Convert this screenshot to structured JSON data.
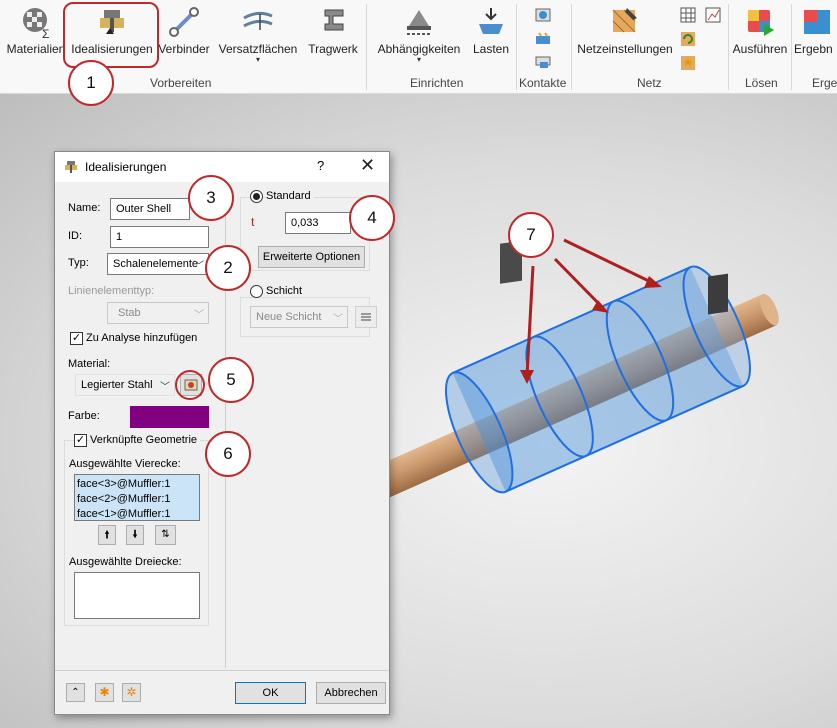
{
  "ribbon": {
    "buttons": [
      {
        "label": "Materialien"
      },
      {
        "label": "Idealisierungen"
      },
      {
        "label": "Verbinder"
      },
      {
        "label": "Versatzflächen"
      },
      {
        "label": "Tragwerk"
      },
      {
        "label": "Abhängigkeiten"
      },
      {
        "label": "Lasten"
      },
      {
        "label": "Netzeinstellungen"
      },
      {
        "label": "Ausführen"
      },
      {
        "label": "Ergebn"
      }
    ],
    "groups": [
      "Vorbereiten",
      "Einrichten",
      "Kontakte",
      "Netz",
      "Lösen",
      "Erge"
    ]
  },
  "dialog": {
    "title": "Idealisierungen",
    "help": "?",
    "close": "✕",
    "name_label": "Name:",
    "name_value": "Outer Shell",
    "id_label": "ID:",
    "id_value": "1",
    "type_label": "Typ:",
    "type_value": "Schalenelemente",
    "line_type_label": "Linienelementtyp:",
    "line_type_value": "Stab",
    "add_to_analysis": "Zu Analyse hinzufügen",
    "material_label": "Material:",
    "material_value": "Legierter Stahl",
    "color_label": "Farbe:",
    "color_hex": "#800080",
    "linked_geometry": "Verknüpfte Geometrie",
    "quads_label": "Ausgewählte Vierecke:",
    "quads": [
      "face<3>@Muffler:1",
      "face<2>@Muffler:1",
      "face<1>@Muffler:1"
    ],
    "tris_label": "Ausgewählte Dreiecke:",
    "standard_label": "Standard",
    "t_label": "t",
    "t_value": "0,033",
    "advanced_button": "Erweiterte Optionen",
    "layer_label": "Schicht",
    "layer_value": "Neue Schicht",
    "ok": "OK",
    "cancel": "Abbrechen"
  },
  "callouts": [
    "1",
    "2",
    "3",
    "4",
    "5",
    "6",
    "7"
  ],
  "colors": {
    "callout_border": "#c0282a",
    "arrow": "#b01e1e",
    "shell_fill": "#4a90d9",
    "shell_edge": "#1f6fe0",
    "rod": "#c8956a"
  }
}
